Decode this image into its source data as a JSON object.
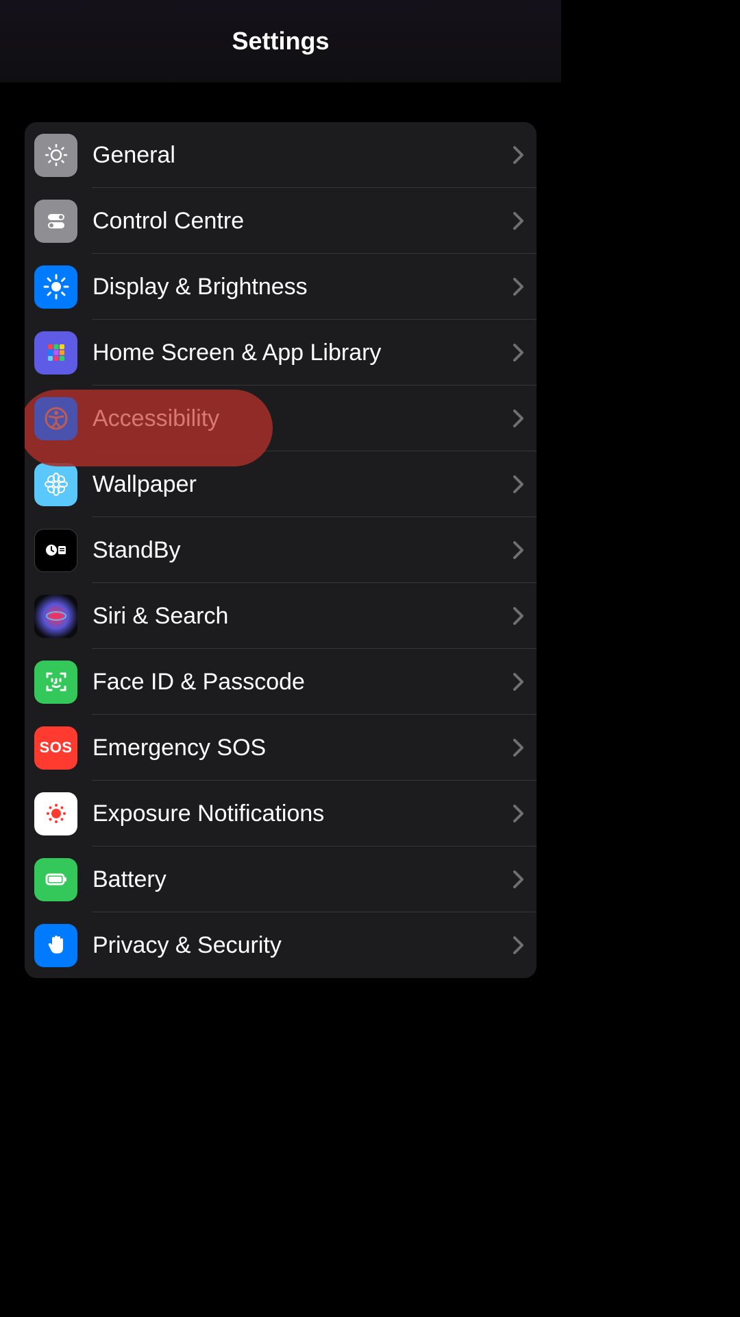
{
  "header": {
    "title": "Settings"
  },
  "items": [
    {
      "label": "General",
      "icon": "gear-icon",
      "bg": "bg-gray"
    },
    {
      "label": "Control Centre",
      "icon": "toggles-icon",
      "bg": "bg-gray"
    },
    {
      "label": "Display & Brightness",
      "icon": "sun-icon",
      "bg": "bg-blue"
    },
    {
      "label": "Home Screen & App Library",
      "icon": "app-grid-icon",
      "bg": "bg-indigo"
    },
    {
      "label": "Accessibility",
      "icon": "accessibility-icon",
      "bg": "bg-accessibility",
      "highlighted": true
    },
    {
      "label": "Wallpaper",
      "icon": "flower-icon",
      "bg": "bg-cyan"
    },
    {
      "label": "StandBy",
      "icon": "clock-widget-icon",
      "bg": "bg-black"
    },
    {
      "label": "Siri & Search",
      "icon": "siri-icon",
      "bg": "bg-siri"
    },
    {
      "label": "Face ID & Passcode",
      "icon": "faceid-icon",
      "bg": "bg-green"
    },
    {
      "label": "Emergency SOS",
      "icon": "sos-icon",
      "bg": "bg-red"
    },
    {
      "label": "Exposure Notifications",
      "icon": "exposure-icon",
      "bg": "bg-white"
    },
    {
      "label": "Battery",
      "icon": "battery-icon",
      "bg": "bg-green"
    },
    {
      "label": "Privacy & Security",
      "icon": "hand-icon",
      "bg": "bg-blue"
    }
  ]
}
